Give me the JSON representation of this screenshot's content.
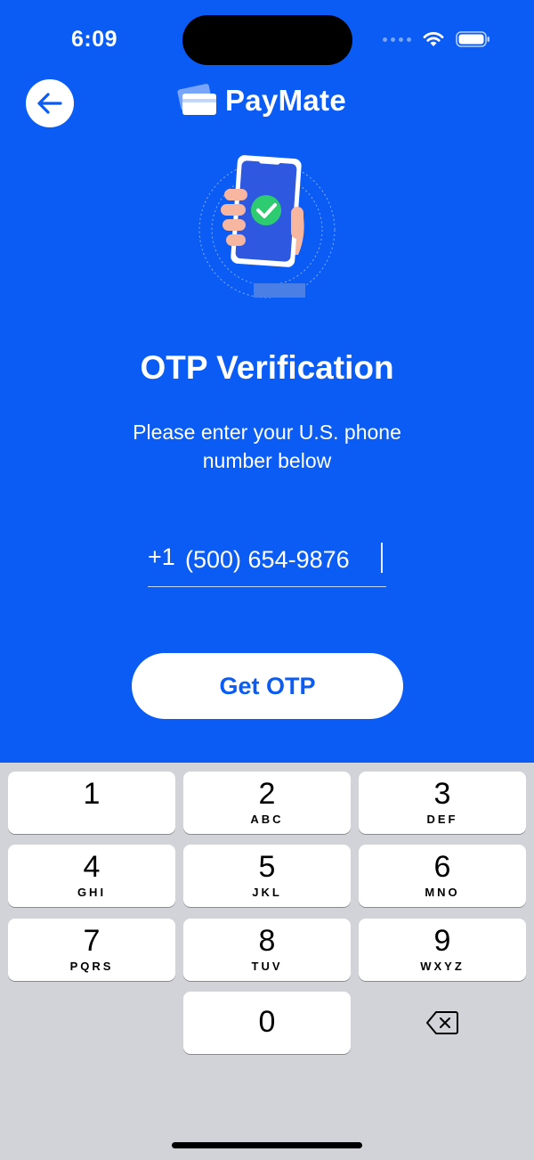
{
  "status_bar": {
    "time": "6:09"
  },
  "header": {
    "back_icon": "arrow-left-icon",
    "brand_name": "PayMate",
    "brand_icon": "cards-icon"
  },
  "main": {
    "illustration": "phone-check-illustration",
    "title": "OTP Verification",
    "subtitle": "Please enter your U.S. phone number below",
    "phone": {
      "prefix": "+1",
      "value": "(500) 654-9876"
    },
    "button_label": "Get OTP"
  },
  "colors": {
    "primary": "#0a5cf5",
    "keypad_bg": "#d1d3d9",
    "key_bg": "#ffffff",
    "success": "#2ecc71"
  },
  "keypad": {
    "keys": [
      {
        "digit": "1",
        "letters": ""
      },
      {
        "digit": "2",
        "letters": "ABC"
      },
      {
        "digit": "3",
        "letters": "DEF"
      },
      {
        "digit": "4",
        "letters": "GHI"
      },
      {
        "digit": "5",
        "letters": "JKL"
      },
      {
        "digit": "6",
        "letters": "MNO"
      },
      {
        "digit": "7",
        "letters": "PQRS"
      },
      {
        "digit": "8",
        "letters": "TUV"
      },
      {
        "digit": "9",
        "letters": "WXYZ"
      },
      {
        "digit": "0",
        "letters": ""
      }
    ],
    "delete_icon": "backspace-icon"
  }
}
